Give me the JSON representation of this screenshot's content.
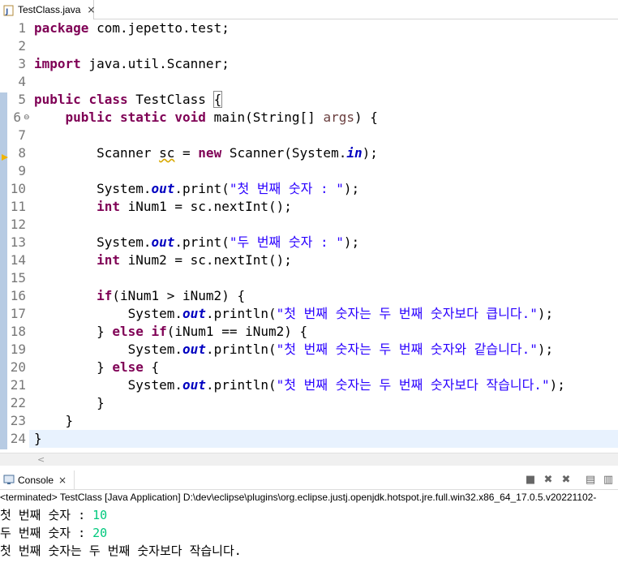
{
  "editor_tab": {
    "filename": "TestClass.java",
    "close": "×"
  },
  "line_numbers": [
    "1",
    "2",
    "3",
    "4",
    "5",
    "6",
    "7",
    "8",
    "9",
    "10",
    "11",
    "12",
    "13",
    "14",
    "15",
    "16",
    "17",
    "18",
    "19",
    "20",
    "21",
    "22",
    "23",
    "24"
  ],
  "code": {
    "l1": {
      "kw": "package",
      "rest": " com.jepetto.test;"
    },
    "l3": {
      "kw": "import",
      "rest": " java.util.Scanner;"
    },
    "l5": {
      "kw1": "public",
      "kw2": "class",
      "name": " TestClass ",
      "brace": "{"
    },
    "l6": {
      "indent": "    ",
      "kw1": "public",
      "kw2": "static",
      "kw3": "void",
      "sig": " main(String[] ",
      "param": "args",
      "end": ") {"
    },
    "l8": {
      "indent": "        ",
      "a": "Scanner ",
      "var": "sc",
      "b": " = ",
      "kw": "new",
      "c": " Scanner(System.",
      "fld": "in",
      "d": ");"
    },
    "l10": {
      "indent": "        ",
      "a": "System.",
      "fld": "out",
      "b": ".print(",
      "str": "\"첫 번째 숫자 : \"",
      "c": ");"
    },
    "l11": {
      "indent": "        ",
      "kw": "int",
      "rest": " iNum1 = sc.nextInt();"
    },
    "l13": {
      "indent": "        ",
      "a": "System.",
      "fld": "out",
      "b": ".print(",
      "str": "\"두 번째 숫자 : \"",
      "c": ");"
    },
    "l14": {
      "indent": "        ",
      "kw": "int",
      "rest": " iNum2 = sc.nextInt();"
    },
    "l16": {
      "indent": "        ",
      "kw": "if",
      "rest": "(iNum1 > iNum2) {"
    },
    "l17": {
      "indent": "            ",
      "a": "System.",
      "fld": "out",
      "b": ".println(",
      "str": "\"첫 번째 숫자는 두 번째 숫자보다 큽니다.\"",
      "c": ");"
    },
    "l18": {
      "indent": "        ",
      "a": "} ",
      "kw1": "else",
      "b": " ",
      "kw2": "if",
      "c": "(iNum1 == iNum2) {"
    },
    "l19": {
      "indent": "            ",
      "a": "System.",
      "fld": "out",
      "b": ".println(",
      "str": "\"첫 번째 숫자는 두 번째 숫자와 같습니다.\"",
      "c": ");"
    },
    "l20": {
      "indent": "        ",
      "a": "} ",
      "kw": "else",
      "b": " {"
    },
    "l21": {
      "indent": "            ",
      "a": "System.",
      "fld": "out",
      "b": ".println(",
      "str": "\"첫 번째 숫자는 두 번째 숫자보다 작습니다.\"",
      "c": ");"
    },
    "l22": {
      "text": "        }"
    },
    "l23": {
      "text": "    }"
    },
    "l24": {
      "text": "}"
    }
  },
  "console": {
    "tab_label": "Console",
    "close": "×",
    "status": "<terminated> TestClass [Java Application] D:\\dev\\eclipse\\plugins\\org.eclipse.justj.openjdk.hotspot.jre.full.win32.x86_64_17.0.5.v20221102-",
    "output": [
      {
        "prompt": "첫 번째 숫자 : ",
        "input": "10"
      },
      {
        "prompt": "두 번째 숫자 : ",
        "input": "20"
      },
      {
        "prompt": "첫 번째 숫자는 두 번째 숫자보다 작습니다.",
        "input": ""
      }
    ]
  },
  "colors": {
    "keyword": "#7f0055",
    "string": "#2a00ff",
    "field": "#0000c0",
    "input": "#00c87d",
    "line_highlight": "#e8f2fe"
  },
  "icons": [
    "java-file-icon",
    "console-icon",
    "terminate-icon",
    "remove-launch-icon",
    "remove-all-icon",
    "scroll-lock-icon",
    "pin-icon"
  ]
}
